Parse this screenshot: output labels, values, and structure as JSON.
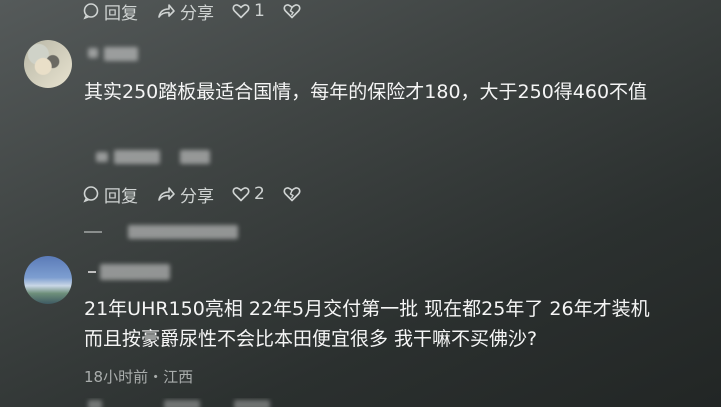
{
  "top_actions": {
    "reply": "回复",
    "share": "分享",
    "like_count": "1"
  },
  "comment1": {
    "username": "• ▪▪▪",
    "text": "其实250踏板最适合国情，每年的保险才180，大于250得460不值",
    "actions": {
      "reply": "回复",
      "share": "分享",
      "like_count": "2"
    }
  },
  "comment2": {
    "username": "— ▪▪▪",
    "text_line1": "21年UHR150亮相 22年5月交付第一批 现在都25年了 26年才装机",
    "text_line2": "而且按豪爵尿性不会比本田便宜很多 我干嘛不买佛沙?",
    "meta": "18小时前・江西"
  },
  "colors": {
    "background": "#3f4443",
    "text": "#f5f5f5",
    "muted": "#a9adac"
  }
}
